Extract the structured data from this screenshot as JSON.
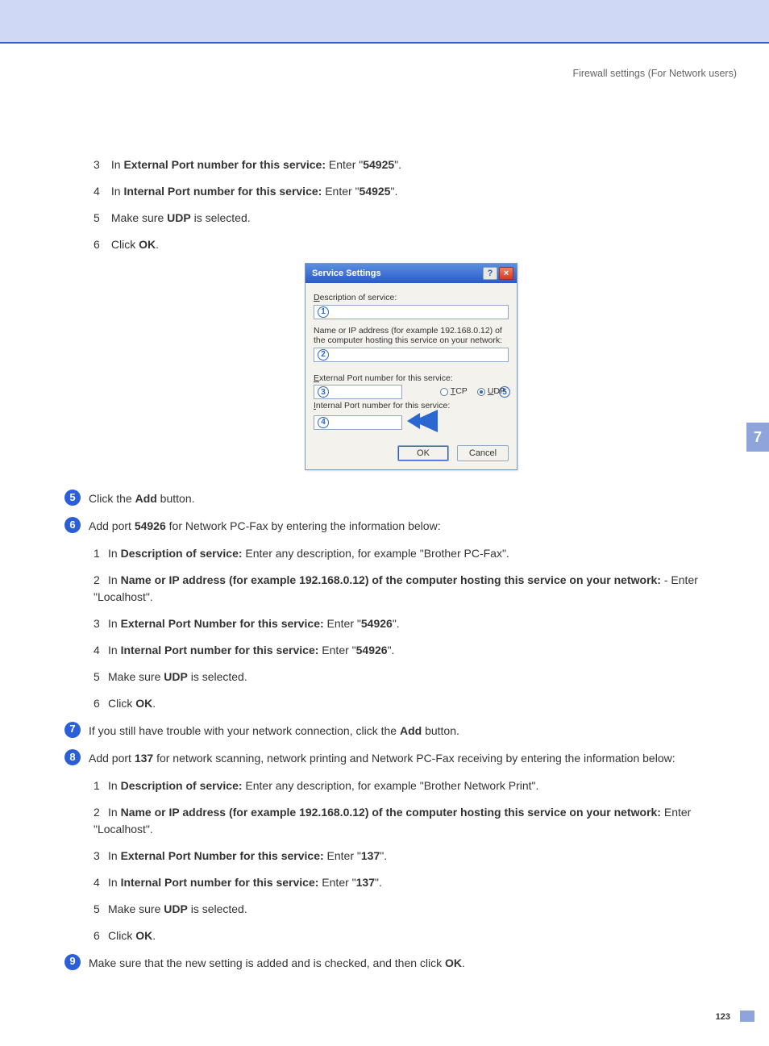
{
  "header": "Firewall settings (For Network users)",
  "chapter_tab": "7",
  "page_number": "123",
  "top_sub": {
    "n3": {
      "prefix": "In ",
      "bold": "External Port number for this service:",
      "mid": " Enter \"",
      "val": "54925",
      "suffix": "\"."
    },
    "n4": {
      "prefix": "In ",
      "bold": "Internal Port number for this service:",
      "mid": " Enter \"",
      "val": "54925",
      "suffix": "\"."
    },
    "n5": {
      "prefix": "Make sure ",
      "bold": "UDP",
      "suffix": " is selected."
    },
    "n6": {
      "prefix": "Click ",
      "bold": "OK",
      "suffix": "."
    }
  },
  "dialog": {
    "title": "Service Settings",
    "desc_label": "Description of service:",
    "ip_label": "Name or IP address (for example 192.168.0.12) of the computer hosting this service on your network:",
    "ext_label": "External Port number for this service:",
    "int_label": "Internal Port number for this service:",
    "tcp": "TCP",
    "udp": "UDP",
    "ok": "OK",
    "cancel": "Cancel"
  },
  "step5": {
    "prefix": "Click the ",
    "bold": "Add",
    "suffix": " button."
  },
  "step6_intro": {
    "p1": "Add port ",
    "port": "54926",
    "p2": " for Network PC-Fax by entering the information below:"
  },
  "step6_sub": {
    "n1": {
      "prefix": "In ",
      "bold": "Description of service:",
      "suffix": " Enter any description, for example \"Brother PC-Fax\"."
    },
    "n2": {
      "prefix": "In ",
      "bold": "Name or IP address (for example 192.168.0.12) of the computer hosting this service on your network:",
      "suffix": " - Enter \"Localhost\"."
    },
    "n3": {
      "prefix": "In ",
      "bold": "External Port Number for this service:",
      "mid": " Enter \"",
      "val": "54926",
      "suffix": "\"."
    },
    "n4": {
      "prefix": "In ",
      "bold": "Internal Port number for this service:",
      "mid": " Enter \"",
      "val": "54926",
      "suffix": "\"."
    },
    "n5": {
      "prefix": "Make sure ",
      "bold": "UDP",
      "suffix": " is selected."
    },
    "n6": {
      "prefix": "Click ",
      "bold": "OK",
      "suffix": "."
    }
  },
  "step7": {
    "p1": "If you still have trouble with your network connection, click the ",
    "bold": "Add",
    "p2": " button."
  },
  "step8_intro": {
    "p1": "Add port ",
    "port": "137",
    "p2": " for network scanning, network printing and Network PC-Fax receiving by entering the information below:"
  },
  "step8_sub": {
    "n1": {
      "prefix": "In ",
      "bold": "Description of service:",
      "suffix": " Enter any description, for example \"Brother Network Print\"."
    },
    "n2": {
      "prefix": "In ",
      "bold": "Name or IP address (for example 192.168.0.12) of the computer hosting this service on your network:",
      "suffix": " Enter \"Localhost\"."
    },
    "n3": {
      "prefix": "In ",
      "bold": "External Port Number for this service:",
      "mid": " Enter \"",
      "val": "137",
      "suffix": "\"."
    },
    "n4": {
      "prefix": "In ",
      "bold": "Internal Port number for this service:",
      "mid": " Enter \"",
      "val": "137",
      "suffix": "\"."
    },
    "n5": {
      "prefix": "Make sure ",
      "bold": "UDP",
      "suffix": " is selected."
    },
    "n6": {
      "prefix": "Click ",
      "bold": "OK",
      "suffix": "."
    }
  },
  "step9": {
    "p1": "Make sure that the new setting is added and is checked, and then click ",
    "bold": "OK",
    "p2": "."
  }
}
